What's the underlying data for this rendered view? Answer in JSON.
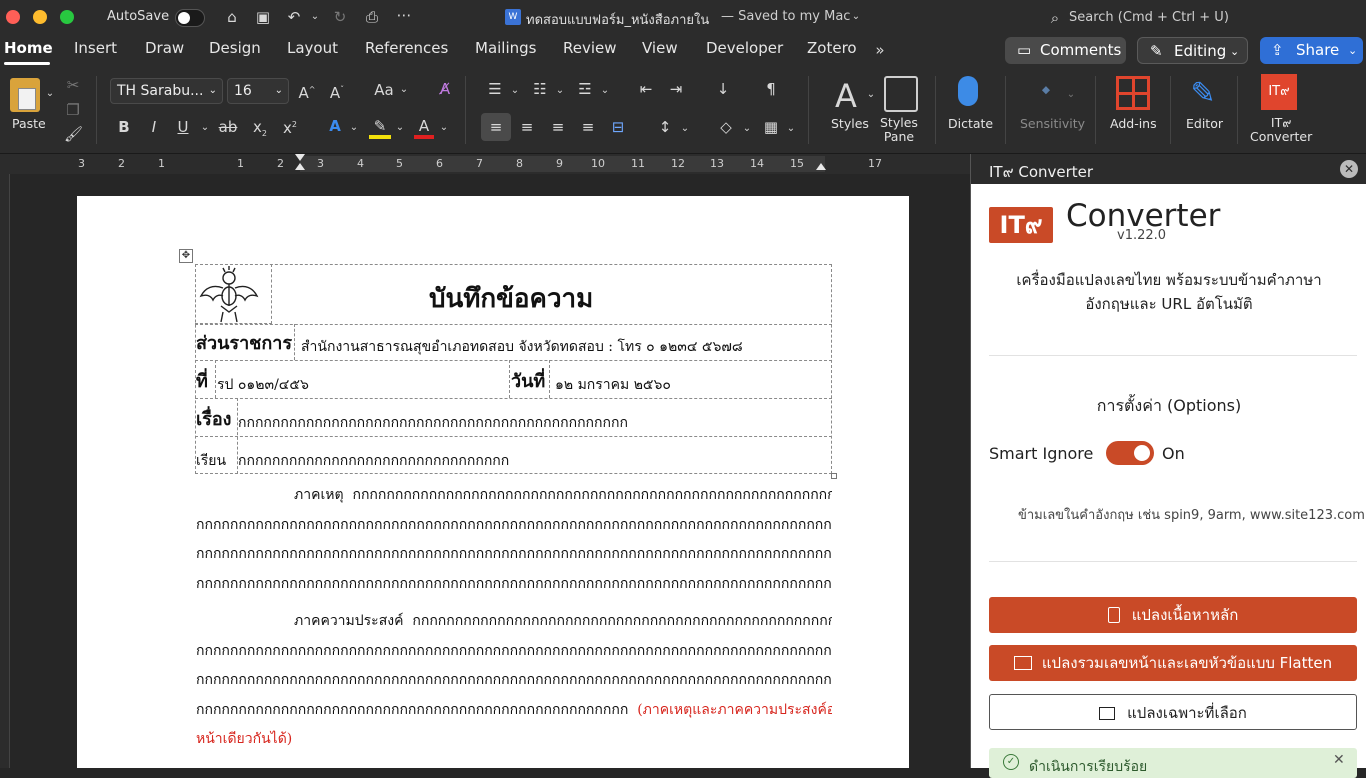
{
  "titlebar": {
    "autosave_label": "AutoSave",
    "doc_title": "ทดสอบแบบฟอร์ม_หนังสือภายใน",
    "saved_status": "— Saved to my Mac",
    "search_placeholder": "Search (Cmd + Ctrl + U)"
  },
  "tabs": [
    "Home",
    "Insert",
    "Draw",
    "Design",
    "Layout",
    "References",
    "Mailings",
    "Review",
    "View",
    "Developer",
    "Zotero"
  ],
  "top_buttons": {
    "comments": "Comments",
    "editing": "Editing",
    "share": "Share"
  },
  "ribbon": {
    "paste_label": "Paste",
    "font_name": "TH Sarabu...",
    "font_size": "16",
    "styles_label": "Styles",
    "styles_pane_label": "Styles\nPane",
    "dictate_label": "Dictate",
    "sensitivity_label": "Sensitivity",
    "addins_label": "Add-ins",
    "editor_label": "Editor",
    "it9_label": "IT๙\nConverter"
  },
  "ruler_numbers": [
    "3",
    "2",
    "1",
    "1",
    "2",
    "3",
    "4",
    "5",
    "6",
    "7",
    "8",
    "9",
    "10",
    "11",
    "12",
    "13",
    "14",
    "15",
    "17"
  ],
  "document": {
    "memo_title": "บันทึกข้อความ",
    "agency_label": "ส่วนราชการ",
    "agency_value": "สำนักงานสาธารณสุขอำเภอทดสอบ จังหวัดทดสอบ : โทร ๐ ๑๒๓๔ ๕๖๗๘",
    "ref_label": "ที่",
    "ref_value": "รป ๐๑๒๓/๔๕๖",
    "date_label": "วันที่",
    "date_value": "๑๒ มกราคม ๒๕๖๐",
    "subject_label": "เรื่อง",
    "subject_value": "กกกกกกกกกกกกกกกกกกกกกกกกกกกกกกกกกกกกกกกกกกกกกก",
    "to_label": "เรียน",
    "to_value": "กกกกกกกกกกกกกกกกกกกกกกกกกกกกกกกก",
    "para1_lead": "ภาคเหตุ",
    "para1_lines": [
      "กกกกกกกกกกกกกกกกกกกกกกกกกกกกกกกกกกกกกกกกกกกกกกกกกกกกกกกกกกกกกกกกกกกกกกก",
      "กกกกกกกกกกกกกกกกกกกกกกกกกกกกกกกกกกกกกกกกกกกกกกกกกกกกกกกกกกกกกกกกกกกกกกกกกกกกกกกกกกกกกกกก",
      "กกกกกกกกกกกกกกกกกกกกกกกกกกกกกกกกกกกกกกกกกกกกกกกกกกกกกกกกกกกกกกกกกกกกกกกกกกกกกกกกกกกกกกกกก",
      "กกกกกกกกกกกกกกกกกกกกกกกกกกกกกกกกกกกกกกกกกกกกกกกกกกกกกกกกกกกกกกกกกกกกกกกกกกกกกกก"
    ],
    "para2_lead": "ภาคความประสงค์",
    "para2_lines": [
      "กกกกกกกกกกกกกกกกกกกกกกกกกกกกกกกกกกกกกกกกกกกกกกกกกกกกกกกกกกกกกกกกกกกกกกก",
      "กกกกกกกกกกกกกกกกกกกกกกกกกกกกกกกกกกกกกกกกกกกกกกกกกกกกกกกกกกกกกกกกกกกกกกกกกกกกกกกกกกกกกก",
      "กกกกกกกกกกกกกกกกกกกกกกกกกกกกกกกกกกกกกกกกกกกกกกกกกกกกกกกกกกกกกกกกกกกกกกกกกกกกกกกกกกกกกกก",
      "กกกกกกกกกกกกกกกกกกกกกกกกกกกกกกกกกกกกกกกกกกกกกกกกกกก"
    ],
    "para2_note_1": "(ภาคเหตุและภาคความประสงค์อาจจะอยู่ในย่อ",
    "para2_note_2": "หน้าเดียวกันได้)"
  },
  "panel": {
    "header_title": "IT๙ Converter",
    "logo_text": "IT๙",
    "app_name": "Converter",
    "version": "v1.22.0",
    "description_1": "เครื่องมือแปลงเลขไทย พร้อมระบบข้ามคำภาษา",
    "description_2": "อังกฤษและ URL อัตโนมัติ",
    "options_title": "การตั้งค่า (Options)",
    "smart_ignore_label": "Smart Ignore",
    "smart_ignore_state": "On",
    "hint": "ข้ามเลขในคำอังกฤษ เช่น spin9, 9arm, www.site123.com",
    "btn_main": "แปลงเนื้อหาหลัก",
    "btn_flatten": "แปลงรวมเลขหน้าและเลขหัวข้อแบบ Flatten",
    "btn_selection": "แปลงเฉพาะที่เลือก",
    "status_text": "ดำเนินการเรียบร้อย"
  },
  "colors": {
    "accent": "#c94a27",
    "share": "#2f6fd6",
    "doc_red": "#d7261e"
  }
}
